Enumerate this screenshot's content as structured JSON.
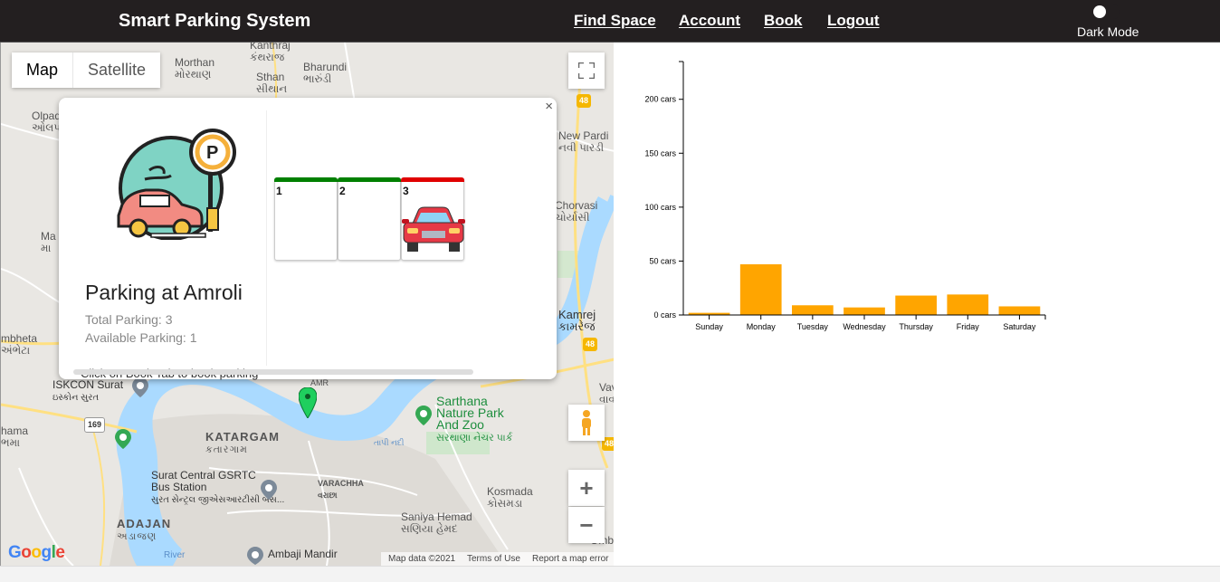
{
  "navbar": {
    "brand": "Smart Parking System",
    "links": [
      "Find Space",
      "Account",
      "Book",
      "Logout"
    ],
    "dark_mode_label": "Dark Mode"
  },
  "map": {
    "type_buttons": [
      "Map",
      "Satellite"
    ],
    "labels": {
      "kanthraj": "Kanthraj",
      "kanthraj_gu": "કંથરાજ",
      "morthan": "Morthan",
      "morthan_gu": "મોરથાણ",
      "bharundi": "Bharundi",
      "bharundi_gu": "ભારુંડી",
      "sthan": "Sthan",
      "sthan_gu": "સીથાન",
      "olpad": "Olpad",
      "olpad_gu": "ઓલપાડ",
      "new_pardi": "New Pardi",
      "new_pardi_gu": "નવી પારડી",
      "chorvasi": "Chorvasi",
      "chorvasi_gu": "ચોર્યાસી",
      "kamrej": "Kamrej",
      "kamrej_gu": "કામરેજ",
      "ambheta": "mbheta",
      "ambheta_gu": "અંભેટા",
      "iskcon": "ISKCON Surat",
      "iskcon_gu": "ઇસ્કોન સુરત",
      "sarthana": "Sarthana Nature Park And Zoo",
      "sarthana_gu": "સરથાણા નેચર પાર્ક",
      "katargam": "KATARGAM",
      "katargam_gu": "કતારગામ",
      "surat_central": "Surat Central GSRTC Bus Station",
      "surat_central_gu": "સુરત સેન્ટ્રલ જીએસઆરટીસી બસ...",
      "varachha": "VARACHHA",
      "varachha_gu": "વરાછા",
      "kosmada": "Kosmada",
      "kosmada_gu": "કોસમડા",
      "saniya": "Saniya Hemad",
      "saniya_gu": "સણિયા હેમદ",
      "adajan": "ADAJAN",
      "adajan_gu": "અડાજણ",
      "ambaji": "Ambaji Mandir",
      "hama": "hama",
      "hama_gu": "ભમા",
      "amroli_small": "AMR",
      "tapi": "તાપી નદી",
      "road_48": "48",
      "road_169": "169",
      "river": "River",
      "vav": "Vav",
      "vav_gu": "વાવ",
      "ma": "Ma",
      "ma_gu": "મા",
      "ombi": "Ombi"
    },
    "popup": {
      "title": "Parking at Amroli",
      "total": "Total Parking: 3",
      "available": "Available Parking: 1",
      "hint": "Click on Book Tab to book parking",
      "close": "×",
      "slots": [
        {
          "num": "1",
          "status": "free",
          "color": "#008000"
        },
        {
          "num": "2",
          "status": "free",
          "color": "#008000"
        },
        {
          "num": "3",
          "status": "occupied",
          "color": "#e00000"
        }
      ]
    },
    "footer": {
      "google": "Google",
      "map_data": "Map data ©2021",
      "terms": "Terms of Use",
      "report": "Report a map error"
    },
    "zoom_in": "+",
    "zoom_out": "−"
  },
  "chart_data": {
    "type": "bar",
    "categories": [
      "Sunday",
      "Monday",
      "Tuesday",
      "Wednesday",
      "Thursday",
      "Friday",
      "Saturday"
    ],
    "values": [
      2,
      47,
      9,
      7,
      18,
      19,
      8
    ],
    "ytick_labels": [
      "0 cars",
      "50 cars",
      "100 cars",
      "150 cars",
      "200 cars"
    ],
    "yticks": [
      0,
      50,
      100,
      150,
      200
    ],
    "ylim": [
      0,
      235
    ],
    "bar_color": "#ffa500",
    "title": "",
    "xlabel": "",
    "ylabel": ""
  }
}
